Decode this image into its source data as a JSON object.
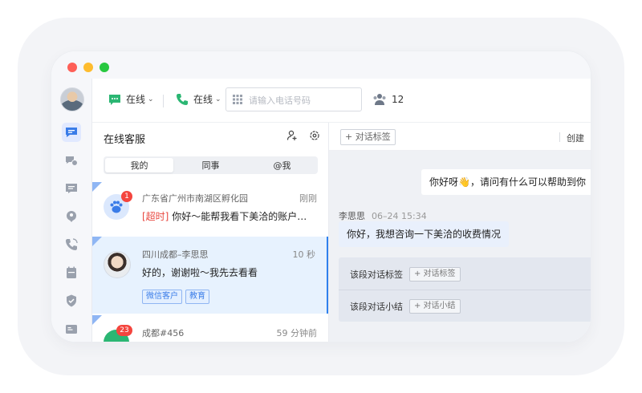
{
  "window": {
    "controls": [
      "close",
      "minimize",
      "maximize"
    ]
  },
  "sidebar": {
    "items": [
      {
        "icon": "chat-bubble-icon",
        "active": true
      },
      {
        "icon": "history-chat-icon"
      },
      {
        "icon": "message-board-icon"
      },
      {
        "icon": "location-icon"
      },
      {
        "icon": "phone-call-icon"
      },
      {
        "icon": "calendar-icon"
      },
      {
        "icon": "shield-check-icon"
      },
      {
        "icon": "id-card-icon"
      }
    ]
  },
  "topbar": {
    "chat_status": "在线",
    "phone_status": "在线",
    "phone_placeholder": "请输入电话号码",
    "queue_count": "12"
  },
  "list": {
    "title": "在线客服",
    "tabs": [
      {
        "label": "我的",
        "active": true
      },
      {
        "label": "同事"
      },
      {
        "label": "@我"
      }
    ],
    "conversations": [
      {
        "title": "广东省广州市南湖区孵化园",
        "time": "刚刚",
        "badge": "1",
        "overtime_tag": "[超时]",
        "message": "你好～能帮我看下美洽的账户…",
        "tags": []
      },
      {
        "title": "四川成都–李思思",
        "time": "10 秒",
        "message": "好的，谢谢啦～我先去看看",
        "tags": [
          "微信客户",
          "教育"
        ]
      },
      {
        "title": "成都#456",
        "time": "59 分钟前",
        "badge": "23"
      }
    ]
  },
  "chat": {
    "tag_button": "+ 对话标签",
    "head_right": "创建",
    "outgoing": "你好呀👋，请问有什么可以帮助到你",
    "incoming_name": "李思思",
    "incoming_time": "06–24 15:34",
    "incoming": "你好，我想咨询一下美洽的收费情况",
    "summary": {
      "tag_label": "该段对话标签",
      "tag_add": "+ 对话标签",
      "summary_label": "该段对话小结",
      "summary_add": "+ 对话小结"
    }
  },
  "colors": {
    "accent": "#2f80ed",
    "badge": "#f4453e",
    "online_green": "#2bb673"
  }
}
